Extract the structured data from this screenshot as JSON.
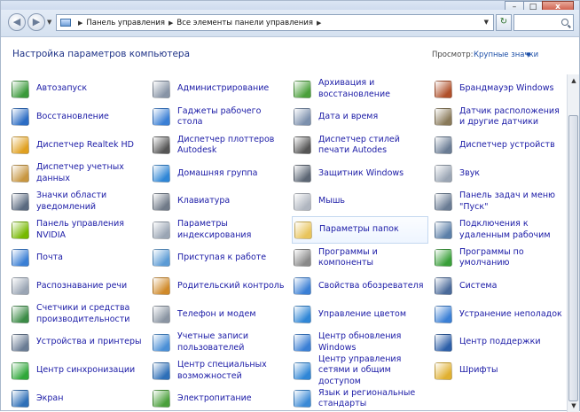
{
  "window_controls": {
    "minimize": "–",
    "maximize": "□",
    "close": "x"
  },
  "nav": {
    "back": "◀",
    "forward": "▶"
  },
  "breadcrumbs": [
    "Панель управления",
    "Все элементы панели управления"
  ],
  "search": {
    "placeholder": ""
  },
  "header": {
    "title": "Настройка параметров компьютера",
    "view_label": "Просмотр:",
    "view_value": "Крупные значки"
  },
  "items": [
    {
      "label": "Автозапуск",
      "icon": "autoplay-icon",
      "color": "#3a9a3a"
    },
    {
      "label": "Восстановление",
      "icon": "recovery-icon",
      "color": "#2b6cc4"
    },
    {
      "label": "Диспетчер Realtek HD",
      "icon": "audio-manager-icon",
      "color": "#e0a020"
    },
    {
      "label": "Диспетчер учетных данных",
      "icon": "credential-manager-icon",
      "color": "#c89640"
    },
    {
      "label": "Значки области уведомлений",
      "icon": "notification-icons-icon",
      "color": "#5a6a80"
    },
    {
      "label": "Панель управления NVIDIA",
      "icon": "nvidia-icon",
      "color": "#76b900"
    },
    {
      "label": "Почта",
      "icon": "mail-icon",
      "color": "#3a7fd5"
    },
    {
      "label": "Распознавание речи",
      "icon": "microphone-icon",
      "color": "#9aa5b4"
    },
    {
      "label": "Счетчики и средства производительности",
      "icon": "performance-icon",
      "color": "#3b8b46"
    },
    {
      "label": "Устройства и принтеры",
      "icon": "printer-icon",
      "color": "#6a7c94"
    },
    {
      "label": "Центр синхронизации",
      "icon": "sync-icon",
      "color": "#2fa83a"
    },
    {
      "label": "Экран",
      "icon": "display-icon",
      "color": "#2d6fb8"
    },
    {
      "label": "Администрирование",
      "icon": "admin-tools-icon",
      "color": "#8894a6"
    },
    {
      "label": "Гаджеты рабочего стола",
      "icon": "gadgets-icon",
      "color": "#3a7fd5"
    },
    {
      "label": "Диспетчер плоттеров Autodesk",
      "icon": "plotter-icon",
      "color": "#555555"
    },
    {
      "label": "Домашняя группа",
      "icon": "homegroup-icon",
      "color": "#2f86d6"
    },
    {
      "label": "Клавиатура",
      "icon": "keyboard-icon",
      "color": "#707a88"
    },
    {
      "label": "Параметры индексирования",
      "icon": "indexing-icon",
      "color": "#9aa5b4"
    },
    {
      "label": "Приступая к работе",
      "icon": "getting-started-icon",
      "color": "#5b9bd5"
    },
    {
      "label": "Родительский контроль",
      "icon": "parental-control-icon",
      "color": "#d08a2a"
    },
    {
      "label": "Телефон и модем",
      "icon": "phone-modem-icon",
      "color": "#8a94a2"
    },
    {
      "label": "Учетные записи пользователей",
      "icon": "user-accounts-icon",
      "color": "#4a8fd6"
    },
    {
      "label": "Центр специальных возможностей",
      "icon": "accessibility-icon",
      "color": "#2d6fb8"
    },
    {
      "label": "Электропитание",
      "icon": "power-icon",
      "color": "#4aa03a"
    },
    {
      "label": "Архивация и восстановление",
      "icon": "backup-icon",
      "color": "#4aa03a"
    },
    {
      "label": "Дата и время",
      "icon": "clock-icon",
      "color": "#7c90ad"
    },
    {
      "label": "Диспетчер стилей печати Autodes",
      "icon": "print-styles-icon",
      "color": "#555555"
    },
    {
      "label": "Защитник Windows",
      "icon": "defender-icon",
      "color": "#5c6674"
    },
    {
      "label": "Мышь",
      "icon": "mouse-icon",
      "color": "#b0b6c0"
    },
    {
      "label": "Параметры папок",
      "icon": "folder-options-icon",
      "color": "#e8c45a"
    },
    {
      "label": "Программы и компоненты",
      "icon": "programs-icon",
      "color": "#8a8a8a"
    },
    {
      "label": "Свойства обозревателя",
      "icon": "internet-options-icon",
      "color": "#3a7fd5"
    },
    {
      "label": "Управление цветом",
      "icon": "color-management-icon",
      "color": "#2f86d6"
    },
    {
      "label": "Центр обновления Windows",
      "icon": "windows-update-icon",
      "color": "#3a7fd5"
    },
    {
      "label": "Центр управления сетями и общим доступом",
      "icon": "network-center-icon",
      "color": "#2f86d6"
    },
    {
      "label": "Язык и региональные стандарты",
      "icon": "region-language-icon",
      "color": "#3a8ad6"
    },
    {
      "label": "Брандмауэр Windows",
      "icon": "firewall-icon",
      "color": "#b0502a"
    },
    {
      "label": "Датчик расположения и другие датчики",
      "icon": "sensor-icon",
      "color": "#8a7a5a"
    },
    {
      "label": "Диспетчер устройств",
      "icon": "device-manager-icon",
      "color": "#6a7c94"
    },
    {
      "label": "Звук",
      "icon": "sound-icon",
      "color": "#9aa5b4"
    },
    {
      "label": "Панель задач и меню \"Пуск\"",
      "icon": "taskbar-icon",
      "color": "#6a7c94"
    },
    {
      "label": "Подключения к удаленным рабочим",
      "icon": "remote-desktop-icon",
      "color": "#5b7fa8"
    },
    {
      "label": "Программы по умолчанию",
      "icon": "default-programs-icon",
      "color": "#3aa03a"
    },
    {
      "label": "Система",
      "icon": "system-icon",
      "color": "#4a6a9a"
    },
    {
      "label": "Устранение неполадок",
      "icon": "troubleshooting-icon",
      "color": "#3a7fd5"
    },
    {
      "label": "Центр поддержки",
      "icon": "action-center-icon",
      "color": "#2d5fa8"
    },
    {
      "label": "Шрифты",
      "icon": "fonts-icon",
      "color": "#e0b030"
    }
  ]
}
